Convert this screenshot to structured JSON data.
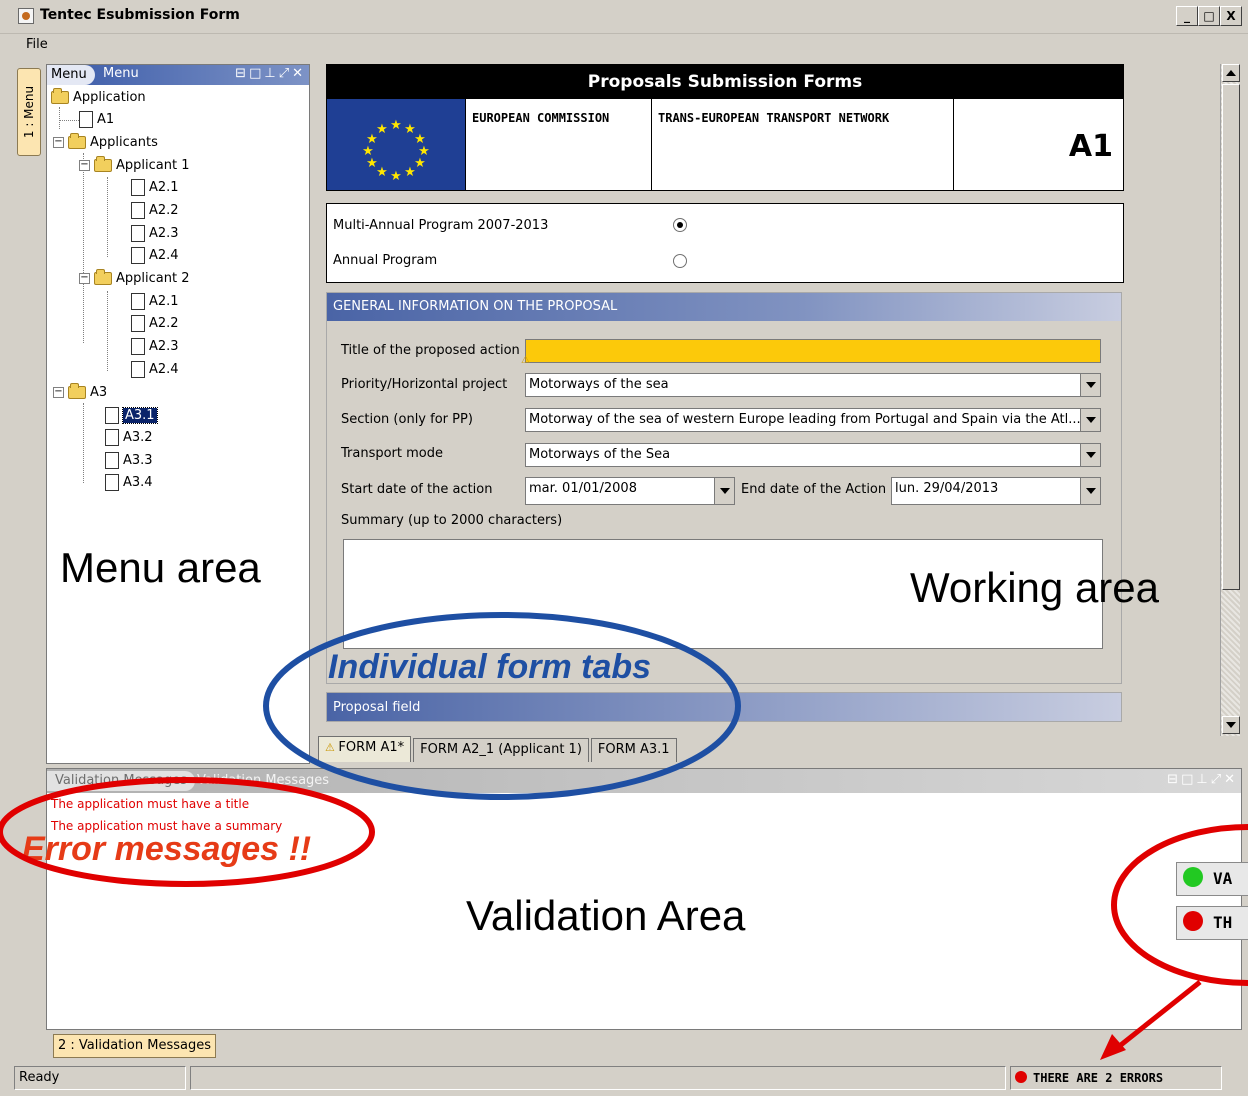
{
  "window": {
    "title": "Tentec Esubmission Form",
    "controls": [
      "_",
      "□",
      "X"
    ]
  },
  "menubar": {
    "file": "File"
  },
  "side_tab": "1 : Menu",
  "menu_panel": {
    "tab_active": "Menu",
    "tab_title": "Menu",
    "tree": {
      "application": "Application",
      "a1": "A1",
      "applicants": "Applicants",
      "applicant1": "Applicant 1",
      "applicant1_items": [
        "A2.1",
        "A2.2",
        "A2.3",
        "A2.4"
      ],
      "applicant2": "Applicant 2",
      "applicant2_items": [
        "A2.1",
        "A2.2",
        "A2.3",
        "A2.4"
      ],
      "a3": "A3",
      "a3_items": [
        "A3.1",
        "A3.2",
        "A3.3",
        "A3.4"
      ],
      "selected": "A3.1"
    }
  },
  "form": {
    "header_title": "Proposals Submission Forms",
    "org1": "EUROPEAN COMMISSION",
    "org2": "TRANS-EUROPEAN TRANSPORT NETWORK",
    "code": "A1",
    "program_multi": "Multi-Annual Program 2007-2013",
    "program_annual": "Annual Program",
    "program_selected": "multi",
    "section_title": "GENERAL INFORMATION ON THE PROPOSAL",
    "labels": {
      "title": "Title of the proposed action",
      "priority": "Priority/Horizontal project",
      "section": "Section (only for PP)",
      "transport": "Transport mode",
      "start": "Start date of the action",
      "end": "End date of the Action",
      "summary": "Summary (up to 2000 characters)"
    },
    "values": {
      "title": "",
      "priority": "Motorways of the sea",
      "section": "Motorway of the sea of western Europe leading from Portugal and Spain via the Atl...",
      "transport": "Motorways of the Sea",
      "start": "mar. 01/01/2008",
      "end": "lun. 29/04/2013",
      "summary": ""
    },
    "proposal_field": "Proposal field"
  },
  "form_tabs": [
    "FORM A1*",
    "FORM A2_1 (Applicant 1)",
    "FORM A3.1"
  ],
  "validation": {
    "tab_active": "Validation Messages",
    "tab_title": "Validation Messages",
    "errors": [
      "The application must have a title",
      "The application must have a summary"
    ],
    "dock_tab": "2 : Validation Messages",
    "callout_valid": "VA",
    "callout_errors": "TH"
  },
  "status": {
    "left": "Ready",
    "errors": "THERE ARE 2 ERRORS"
  },
  "annotations": {
    "menu_area": "Menu area",
    "working_area": "Working area",
    "form_tabs": "Individual form tabs",
    "error_messages": "Error messages !!",
    "validation_area": "Validation Area"
  },
  "colors": {
    "accent_blue": "#1e4fa3",
    "error_red": "#e00000",
    "highlight_yellow": "#fcc90a",
    "annotation_red": "#e63b17"
  }
}
